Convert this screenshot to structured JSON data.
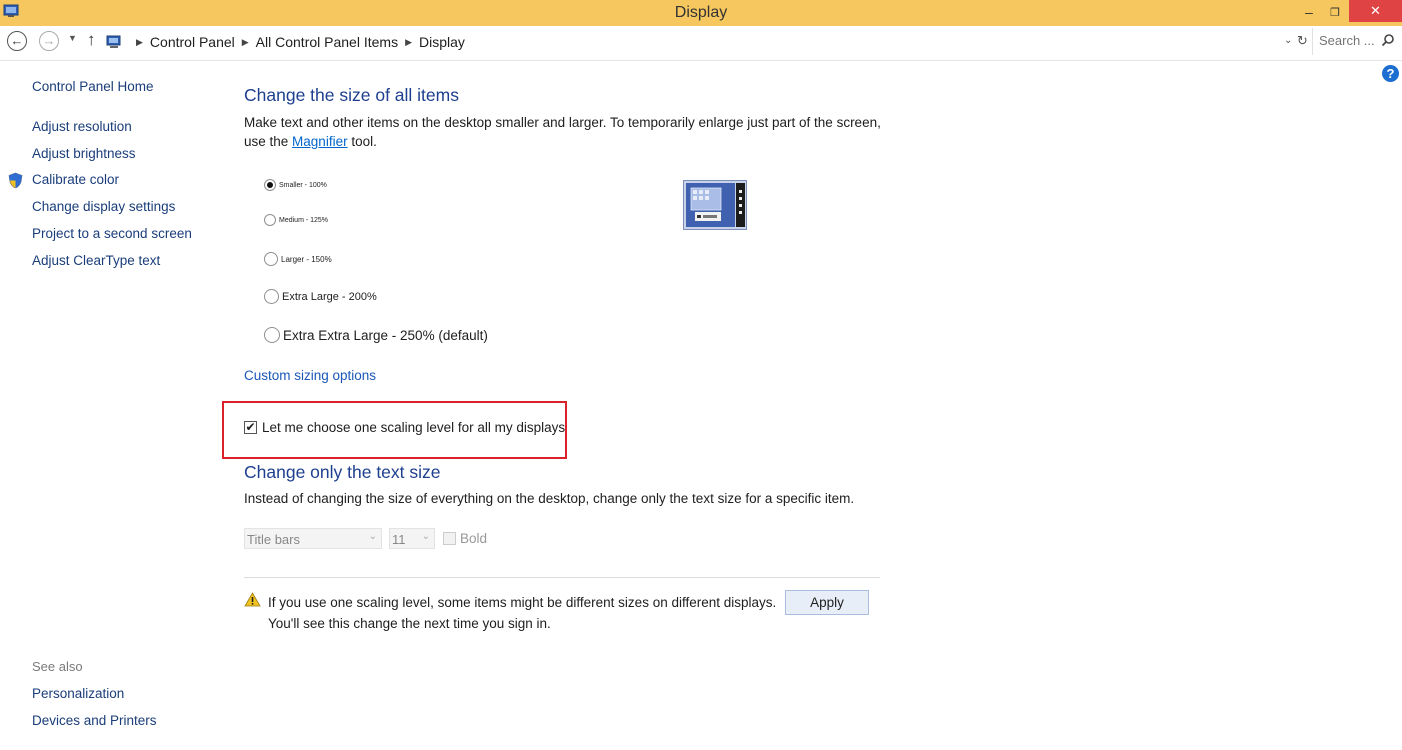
{
  "window": {
    "title": "Display"
  },
  "address": {
    "crumbs": [
      "Control Panel",
      "All Control Panel Items",
      "Display"
    ],
    "search_placeholder": "Search ..."
  },
  "sidebar": {
    "home": "Control Panel Home",
    "items": [
      "Adjust resolution",
      "Adjust brightness",
      "Calibrate color",
      "Change display settings",
      "Project to a second screen",
      "Adjust ClearType text"
    ],
    "see_also_title": "See also",
    "see_also": [
      "Personalization",
      "Devices and Printers"
    ]
  },
  "size_section": {
    "title": "Change the size of all items",
    "desc_before": "Make text and other items on the desktop smaller and larger. To temporarily enlarge just part of the screen, use the ",
    "desc_link": "Magnifier",
    "desc_after": " tool.",
    "options": [
      {
        "label": "Smaller - 100%",
        "selected": true
      },
      {
        "label": "Medium - 125%",
        "selected": false
      },
      {
        "label": "Larger - 150%",
        "selected": false
      },
      {
        "label": "Extra Large - 200%",
        "selected": false
      },
      {
        "label": "Extra Extra Large - 250% (default)",
        "selected": false
      }
    ],
    "custom_link": "Custom sizing options",
    "one_scaling_label": "Let me choose one scaling level for all my displays",
    "one_scaling_checked": true
  },
  "text_section": {
    "title": "Change only the text size",
    "desc": "Instead of changing the size of everything on the desktop, change only the text size for a specific item.",
    "item_select": "Title bars",
    "size_select": "11",
    "bold_label": "Bold"
  },
  "footer": {
    "warning_line1": "If you use one scaling level, some items might be different sizes on different displays.",
    "warning_line2": "You'll see this change the next time you sign in.",
    "apply_label": "Apply"
  },
  "colors": {
    "titlebar": "#f5c75e",
    "close": "#e04343",
    "heading": "#1e3f8f",
    "link": "#1a57b8",
    "highlight": "#d9222a"
  }
}
